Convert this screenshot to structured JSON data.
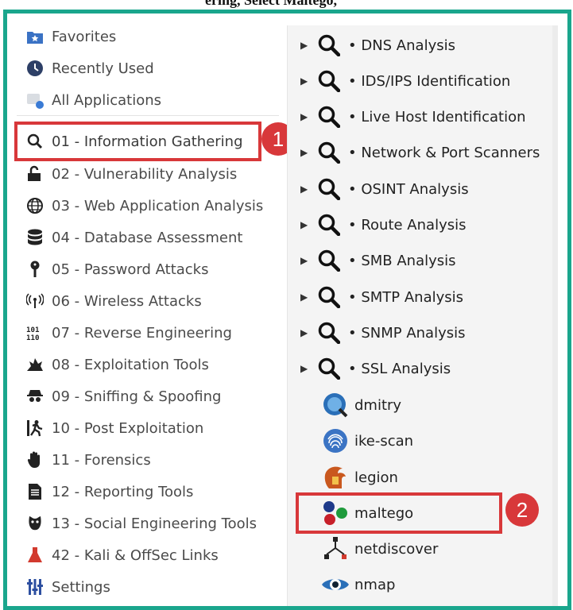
{
  "header_fragment": "ering, Select Maltego,",
  "left_menu": {
    "items": [
      {
        "label": "Favorites",
        "icon": "favorites-folder-icon"
      },
      {
        "label": "Recently Used",
        "icon": "clock-icon"
      },
      {
        "label": "All Applications",
        "icon": "applications-icon"
      },
      {
        "label": "01 - Information Gathering",
        "icon": "search-icon"
      },
      {
        "label": "02 - Vulnerability Analysis",
        "icon": "vulnerability-icon"
      },
      {
        "label": "03 - Web Application Analysis",
        "icon": "globe-icon"
      },
      {
        "label": "04 - Database Assessment",
        "icon": "database-icon"
      },
      {
        "label": "05 - Password Attacks",
        "icon": "key-icon"
      },
      {
        "label": "06 - Wireless Attacks",
        "icon": "wireless-icon"
      },
      {
        "label": "07 - Reverse Engineering",
        "icon": "binary-icon"
      },
      {
        "label": "08 - Exploitation Tools",
        "icon": "explosion-icon"
      },
      {
        "label": "09 - Sniffing & Spoofing",
        "icon": "spy-icon"
      },
      {
        "label": "10 - Post Exploitation",
        "icon": "running-man-icon"
      },
      {
        "label": "11 - Forensics",
        "icon": "hand-icon"
      },
      {
        "label": "12 - Reporting Tools",
        "icon": "document-icon"
      },
      {
        "label": "13 - Social Engineering Tools",
        "icon": "mask-icon"
      },
      {
        "label": "42 - Kali & OffSec Links",
        "icon": "flask-icon"
      },
      {
        "label": "Settings",
        "icon": "settings-sliders-icon"
      }
    ]
  },
  "submenu": {
    "categories": [
      "• DNS Analysis",
      "• IDS/IPS Identification",
      "• Live Host Identification",
      "• Network & Port Scanners",
      "• OSINT Analysis",
      "• Route Analysis",
      "• SMB Analysis",
      "• SMTP Analysis",
      "• SNMP Analysis",
      "• SSL Analysis"
    ],
    "apps": [
      {
        "label": "dmitry",
        "icon": "dmitry-icon"
      },
      {
        "label": "ike-scan",
        "icon": "fingerprint-icon"
      },
      {
        "label": "legion",
        "icon": "spartan-helmet-icon"
      },
      {
        "label": "maltego",
        "icon": "maltego-icon"
      },
      {
        "label": "netdiscover",
        "icon": "network-icon"
      },
      {
        "label": "nmap",
        "icon": "eye-icon"
      }
    ]
  },
  "callouts": {
    "step1": "1",
    "step2": "2"
  },
  "colors": {
    "frame": "#1aa68d",
    "highlight": "#d8383a"
  }
}
